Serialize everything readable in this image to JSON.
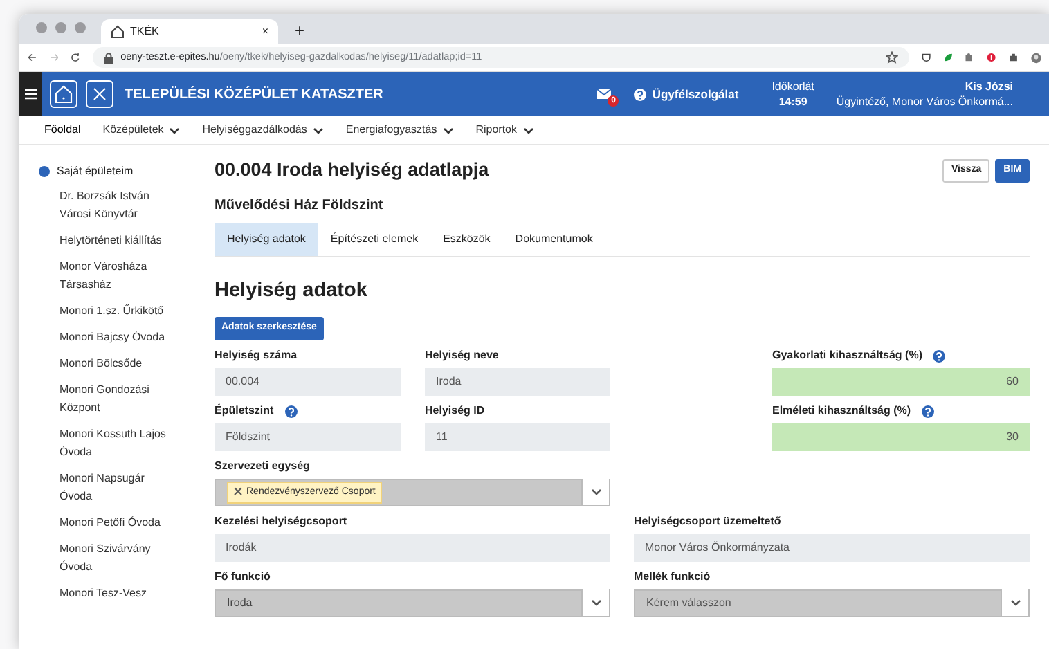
{
  "browser": {
    "tab": {
      "title": "TKÉK",
      "close": "×"
    },
    "new_tab": "+",
    "url_domain": "oeny-teszt.e-epites.hu",
    "url_path": "/oeny/tkek/helyiseg-gazdalkodas/helyiseg/11/adatlap;id=11"
  },
  "header": {
    "title": "TELEPÜLÉSI KÖZÉPÜLET KATASZTER",
    "mail_count": "0",
    "help": "Ügyfélszolgálat",
    "timeout_label": "Időkorlát",
    "timeout": "14:59",
    "user_name": "Kis Józsi",
    "user_role": "Ügyintéző, Monor Város Önkormá..."
  },
  "nav": [
    {
      "label": "Főoldal",
      "dropdown": false,
      "selected": true
    },
    {
      "label": "Középületek",
      "dropdown": true,
      "selected": false
    },
    {
      "label": "Helyiséggazdálkodás",
      "dropdown": true,
      "selected": false
    },
    {
      "label": "Energiafogyasztás",
      "dropdown": true,
      "selected": false
    },
    {
      "label": "Riportok",
      "dropdown": true,
      "selected": false
    }
  ],
  "sidebar": {
    "items": [
      {
        "label": "Saját épületeim",
        "selected": true,
        "children": [
          {
            "label": "Dr. Borzsák István Városi Könyvtár",
            "selected": false
          },
          {
            "label": "Helytörténeti kiállítás",
            "selected": false
          },
          {
            "label": "Monor Városháza Társasház",
            "selected": false
          },
          {
            "label": "Monori 1.sz. Űrkikötő",
            "selected": false
          },
          {
            "label": "Monori Bajcsy Óvoda",
            "selected": false
          },
          {
            "label": "Monori Bölcsőde",
            "selected": false
          },
          {
            "label": "Monori Gondozási Központ",
            "selected": false
          },
          {
            "label": "Monori Kossuth Lajos Óvoda",
            "selected": false
          },
          {
            "label": "Monori Napsugár Óvoda",
            "selected": false
          },
          {
            "label": "Monori Petőfi Óvoda",
            "selected": false
          },
          {
            "label": "Monori Szivárvány Óvoda",
            "selected": false
          },
          {
            "label": "Monori Tesz-Vesz",
            "selected": false
          }
        ]
      }
    ]
  },
  "page": {
    "title": "00.004 Iroda helyiség adatlapja",
    "buttons": [
      {
        "label": "Vissza",
        "kind": "secondary"
      },
      {
        "label": "BIM",
        "kind": "primary"
      }
    ],
    "subtitle": "Művelődési Ház Földszint",
    "tabs": [
      {
        "label": "Helyiség adatok",
        "selected": true
      },
      {
        "label": "Építészeti elemek",
        "selected": false
      },
      {
        "label": "Eszközök",
        "selected": false
      },
      {
        "label": "Dokumentumok",
        "selected": false
      }
    ],
    "section_title": "Helyiség adatok",
    "edit_button": "Adatok szerkesztése",
    "rows": [
      [
        {
          "label": "Helyiség száma",
          "help": false,
          "kind": "text",
          "value": "00.004"
        },
        {
          "label": "Helyiség neve",
          "help": false,
          "kind": "text",
          "value": "Iroda"
        },
        {
          "label": "Gyakorlati kihasználtság (%)",
          "help": true,
          "kind": "metric",
          "value": "60"
        }
      ],
      [
        {
          "label": "Épületszint",
          "help": true,
          "kind": "text",
          "value": "Földszint"
        },
        {
          "label": "Helyiség ID",
          "help": false,
          "kind": "text",
          "value": "11"
        },
        {
          "label": "Elméleti kihasználtság (%)",
          "help": true,
          "kind": "metric",
          "value": "30"
        }
      ],
      [
        {
          "label": "Szervezeti egység",
          "help": false,
          "kind": "select",
          "tags": [
            "Rendezvényszervező Csoport"
          ]
        }
      ],
      [
        {
          "label": "Kezelési helyiségcsoport",
          "help": false,
          "kind": "text",
          "value": "Irodák"
        },
        {
          "label": "Helyiségcsoport üzemeltető",
          "help": false,
          "kind": "text",
          "value": "Monor Város Önkormányzata"
        }
      ],
      [
        {
          "label": "Fő funkció",
          "help": false,
          "kind": "select",
          "value": "Iroda"
        },
        {
          "label": "Mellék funkció",
          "help": false,
          "kind": "select",
          "placeholder": "Kérem válasszon"
        }
      ]
    ]
  }
}
